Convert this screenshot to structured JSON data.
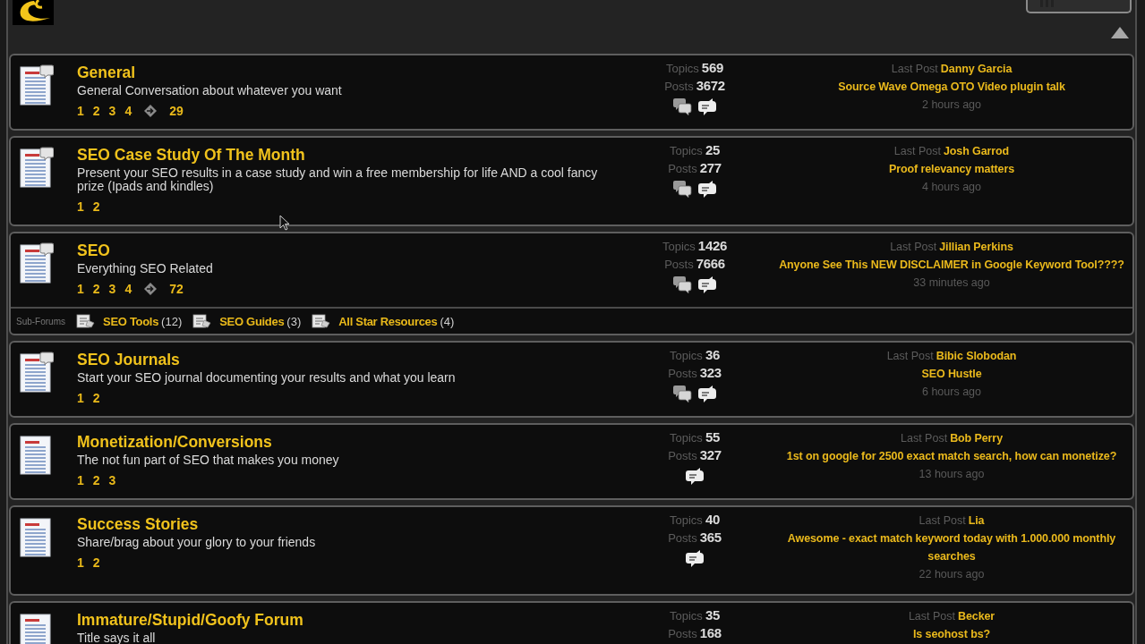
{
  "forums": [
    {
      "title": "General",
      "description": "General Conversation about whatever you want",
      "new_posts": true,
      "pages": [
        "1",
        "2",
        "3",
        "4"
      ],
      "last_page": "29",
      "topics_label": "Topics",
      "topics": "569",
      "posts_label": "Posts",
      "posts": "3672",
      "action_icons": [
        {
          "kind": "bubbles"
        },
        {
          "kind": "bubble"
        }
      ],
      "last_post": {
        "label": "Last Post",
        "author": "Danny Garcia",
        "title": "Source Wave Omega OTO Video plugin talk",
        "time": "2 hours ago"
      }
    },
    {
      "title": "SEO Case Study Of The Month",
      "description": "Present your SEO results in a case study and win a free membership for life AND a cool fancy prize (Ipads and kindles)",
      "new_posts": true,
      "pages": [
        "1",
        "2"
      ],
      "topics_label": "Topics",
      "topics": "25",
      "posts_label": "Posts",
      "posts": "277",
      "action_icons": [
        {
          "kind": "bubbles"
        },
        {
          "kind": "bubble"
        }
      ],
      "last_post": {
        "label": "Last Post",
        "author": "Josh Garrod",
        "title": "Proof relevancy matters",
        "time": "4 hours ago"
      }
    },
    {
      "title": "SEO",
      "description": "Everything SEO Related",
      "new_posts": true,
      "pages": [
        "1",
        "2",
        "3",
        "4"
      ],
      "last_page": "72",
      "topics_label": "Topics",
      "topics": "1426",
      "posts_label": "Posts",
      "posts": "7666",
      "action_icons": [
        {
          "kind": "bubbles"
        },
        {
          "kind": "bubble"
        }
      ],
      "last_post": {
        "label": "Last Post",
        "author": "Jillian Perkins",
        "title": "Anyone See This NEW DISCLAIMER in Google Keyword Tool????",
        "time": "33 minutes ago"
      },
      "subforums": {
        "label": "Sub-Forums",
        "items": [
          {
            "name": "SEO Tools",
            "count": "(12)"
          },
          {
            "name": "SEO Guides",
            "count": "(3)"
          },
          {
            "name": "All Star Resources",
            "count": "(4)"
          }
        ]
      }
    },
    {
      "title": "SEO Journals",
      "description": "Start your SEO journal documenting your results and what you learn",
      "new_posts": true,
      "pages": [
        "1",
        "2"
      ],
      "topics_label": "Topics",
      "topics": "36",
      "posts_label": "Posts",
      "posts": "323",
      "action_icons": [
        {
          "kind": "bubbles"
        },
        {
          "kind": "bubble"
        }
      ],
      "last_post": {
        "label": "Last Post",
        "author": "Bibic Slobodan",
        "title": "SEO Hustle",
        "time": "6 hours ago"
      }
    },
    {
      "title": "Monetization/Conversions",
      "description": "The not fun part of SEO that makes you money",
      "new_posts": false,
      "pages": [
        "1",
        "2",
        "3"
      ],
      "topics_label": "Topics",
      "topics": "55",
      "posts_label": "Posts",
      "posts": "327",
      "action_icons": [
        {
          "kind": "bubble"
        }
      ],
      "last_post": {
        "label": "Last Post",
        "author": "Bob Perry",
        "title": "1st on google for 2500 exact match search, how can monetize?",
        "time": "13 hours ago"
      }
    },
    {
      "title": "Success Stories",
      "description": "Share/brag about your glory to your friends",
      "new_posts": false,
      "pages": [
        "1",
        "2"
      ],
      "topics_label": "Topics",
      "topics": "40",
      "posts_label": "Posts",
      "posts": "365",
      "action_icons": [
        {
          "kind": "bubble"
        }
      ],
      "last_post": {
        "label": "Last Post",
        "author": "Lia",
        "title": "Awesome - exact match keyword today with 1.000.000 monthly searches",
        "time": "22 hours ago"
      }
    },
    {
      "title": "Immature/Stupid/Goofy Forum",
      "description": "Title says it all",
      "new_posts": false,
      "topics_label": "Topics",
      "topics": "35",
      "posts_label": "Posts",
      "posts": "168",
      "last_post": {
        "label": "Last Post",
        "author": "Becker",
        "title": "Is seohost bs?"
      }
    }
  ]
}
